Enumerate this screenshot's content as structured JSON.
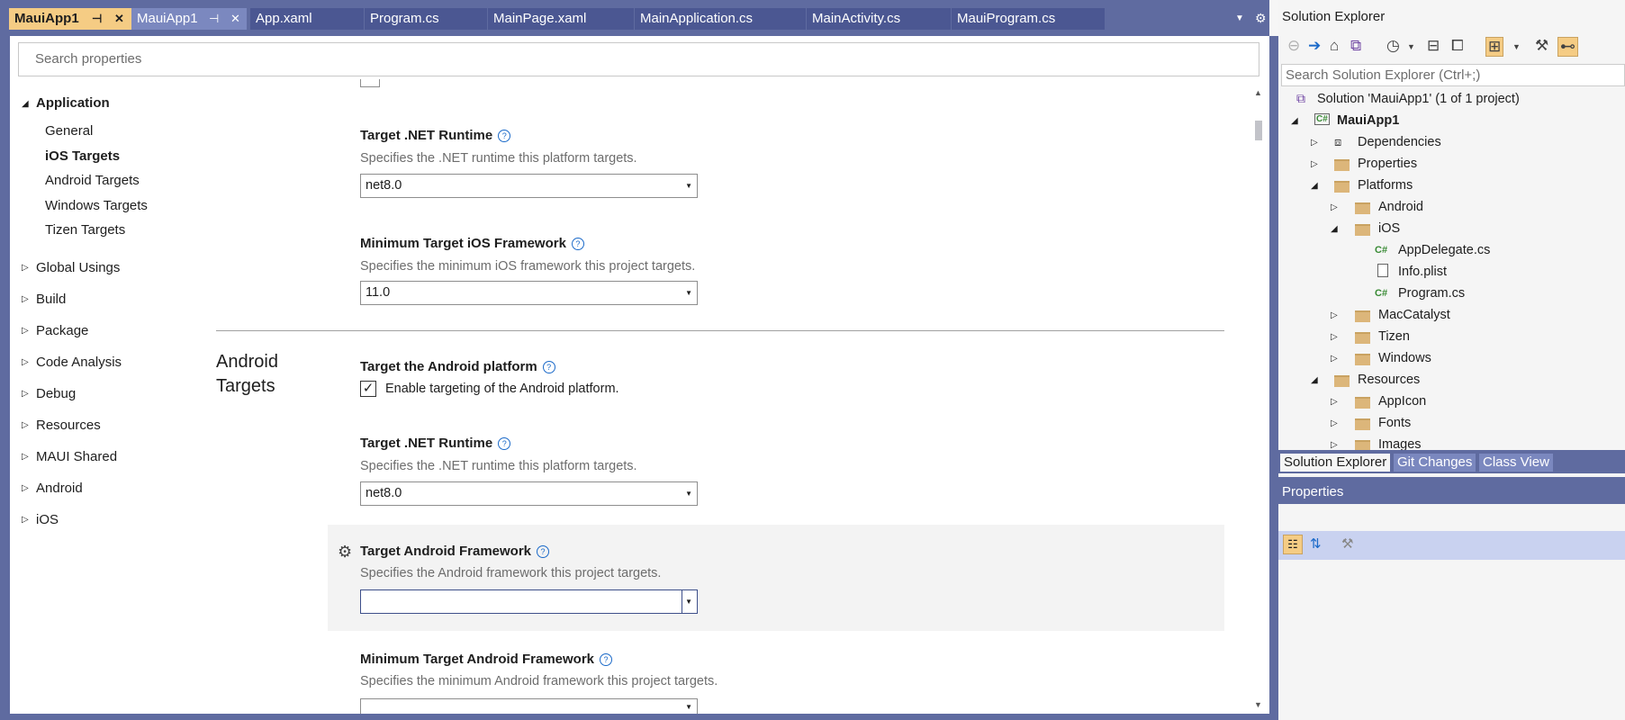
{
  "tabs": [
    {
      "label": "MauiApp1",
      "state": "active"
    },
    {
      "label": "MauiApp1",
      "state": "preview"
    },
    {
      "label": "App.xaml"
    },
    {
      "label": "Program.cs"
    },
    {
      "label": "MainPage.xaml"
    },
    {
      "label": "MainApplication.cs"
    },
    {
      "label": "MainActivity.cs"
    },
    {
      "label": "MauiProgram.cs"
    }
  ],
  "editor": {
    "search_placeholder": "Search properties",
    "nav": {
      "application": "Application",
      "sub": [
        "General",
        "iOS Targets",
        "Android Targets",
        "Windows Targets",
        "Tizen Targets"
      ],
      "groups": [
        "Global Usings",
        "Build",
        "Package",
        "Code Analysis",
        "Debug",
        "Resources",
        "MAUI Shared",
        "Android",
        "iOS"
      ]
    },
    "ios": {
      "runtime_title": "Target .NET Runtime",
      "runtime_desc": "Specifies the .NET runtime this platform targets.",
      "runtime_value": "net8.0",
      "minfw_title": "Minimum Target iOS Framework",
      "minfw_desc": "Specifies the minimum iOS framework this project targets.",
      "minfw_value": "11.0"
    },
    "android": {
      "section_line1": "Android",
      "section_line2": "Targets",
      "platform_title": "Target the Android platform",
      "platform_checkbox": "Enable targeting of the Android platform.",
      "platform_checked": true,
      "runtime_title": "Target .NET Runtime",
      "runtime_desc": "Specifies the .NET runtime this platform targets.",
      "runtime_value": "net8.0",
      "fw_title": "Target Android Framework",
      "fw_desc": "Specifies the Android framework this project targets.",
      "fw_value": "",
      "minfw_title": "Minimum Target Android Framework",
      "minfw_desc": "Specifies the minimum Android framework this project targets."
    }
  },
  "solution_explorer": {
    "title": "Solution Explorer",
    "search_placeholder": "Search Solution Explorer (Ctrl+;)",
    "tree": {
      "solution": "Solution 'MauiApp1' (1 of 1 project)",
      "project": "MauiApp1",
      "dependencies": "Dependencies",
      "properties": "Properties",
      "platforms": "Platforms",
      "android": "Android",
      "ios": "iOS",
      "appdelegate": "AppDelegate.cs",
      "infoplist": "Info.plist",
      "programcs": "Program.cs",
      "maccatalyst": "MacCatalyst",
      "tizen": "Tizen",
      "windows": "Windows",
      "resources": "Resources",
      "appicon": "AppIcon",
      "fonts": "Fonts",
      "images": "Images"
    },
    "bottom_tabs": [
      "Solution Explorer",
      "Git Changes",
      "Class View"
    ]
  },
  "properties_pane": {
    "title": "Properties"
  },
  "colors": {
    "frame": "#5f6ba0",
    "active_tab": "#f5cc84",
    "link": "#1b6ac9"
  }
}
